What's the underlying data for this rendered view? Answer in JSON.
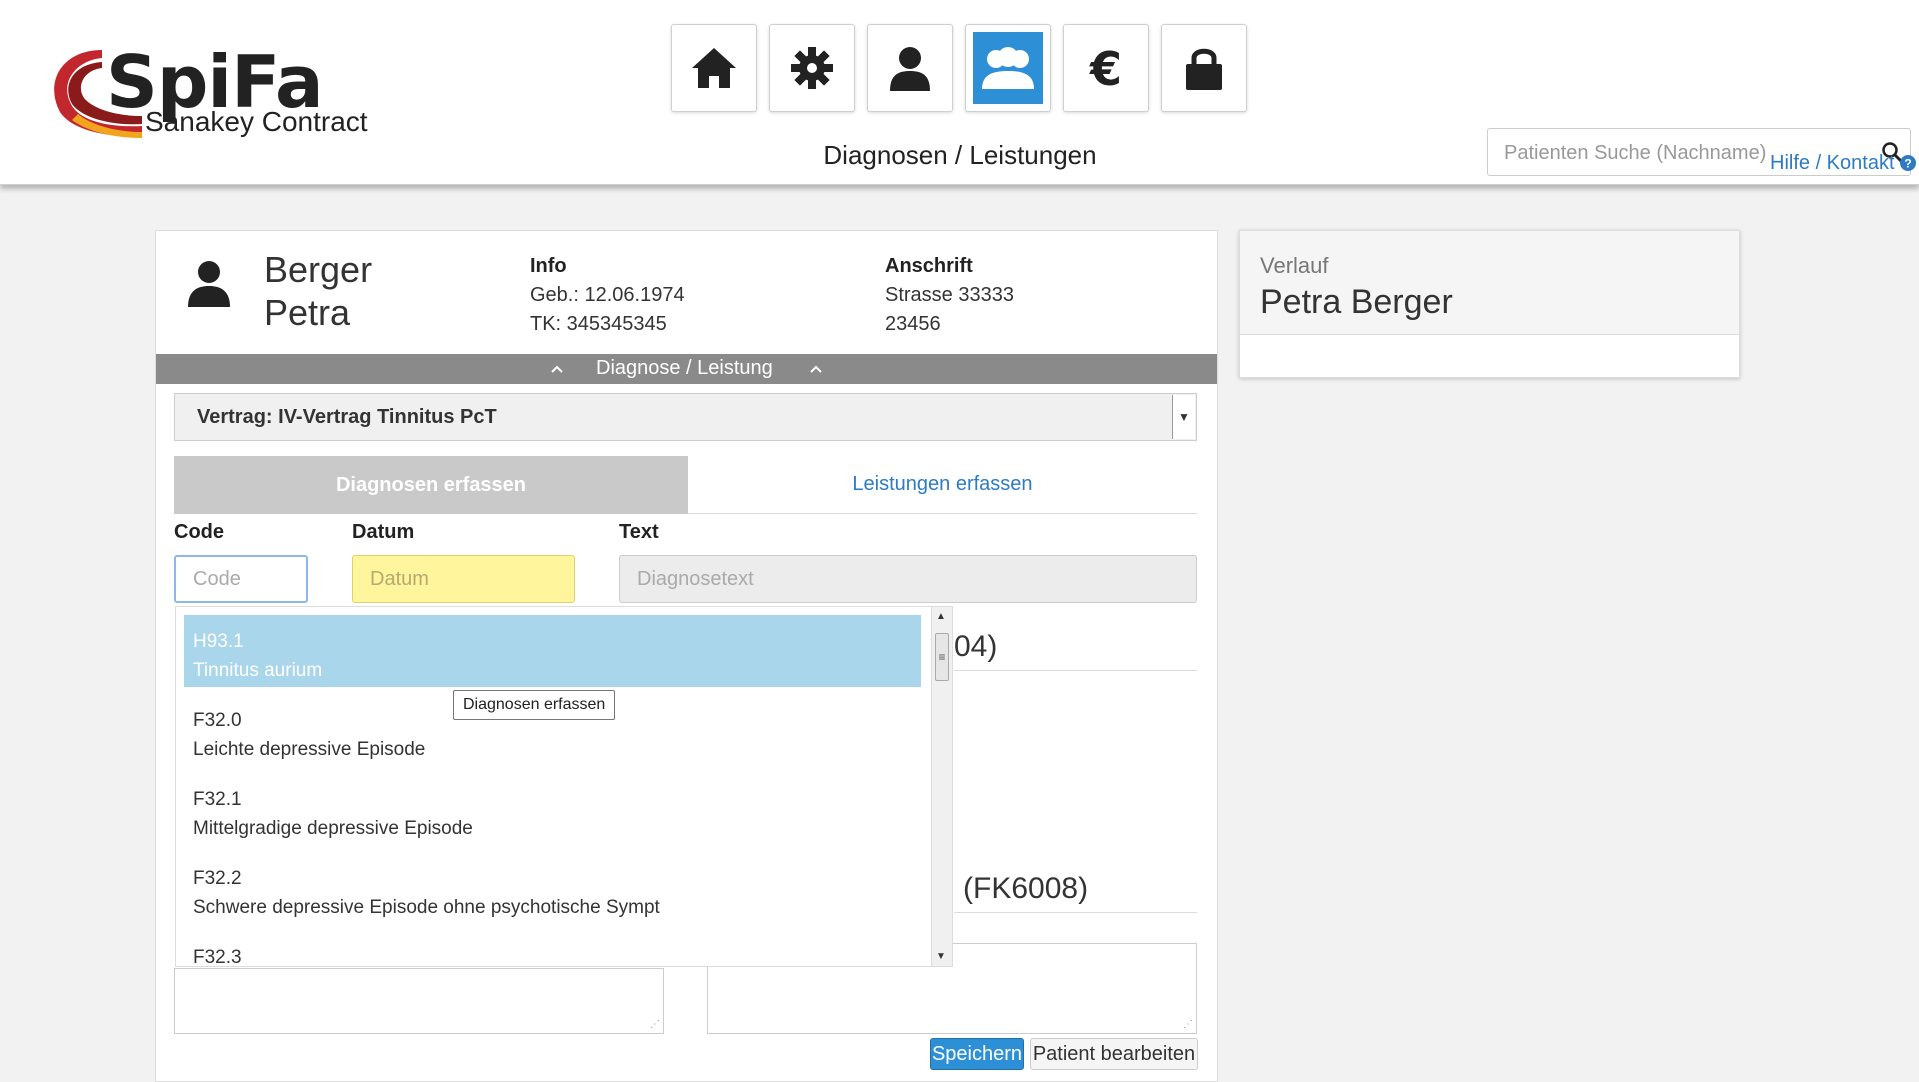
{
  "header": {
    "logo": {
      "word": "SpiFa",
      "subtitle": "Sanakey Contract"
    },
    "nav": [
      {
        "icon": "home-icon",
        "active": false
      },
      {
        "icon": "gear-icon",
        "active": false
      },
      {
        "icon": "user-icon",
        "active": false
      },
      {
        "icon": "users-icon",
        "active": true
      },
      {
        "icon": "euro-icon",
        "active": false
      },
      {
        "icon": "lock-icon",
        "active": false
      }
    ],
    "page_title": "Diagnosen / Leistungen",
    "search_placeholder": "Patienten Suche (Nachname)",
    "help_link": "Hilfe / Kontakt"
  },
  "patient": {
    "last_name": "Berger",
    "first_name": "Petra",
    "info_label": "Info",
    "birth": "Geb.: 12.06.1974",
    "tk": "TK: 345345345",
    "address_label": "Anschrift",
    "street": "Strasse 33333",
    "zip": "23456"
  },
  "section_bar": "Diagnose / Leistung",
  "contract": "Vertrag: IV-Vertrag Tinnitus PcT",
  "tabs": {
    "diagnosen": "Diagnosen erfassen",
    "leistungen": "Leistungen erfassen"
  },
  "fields": {
    "code_label": "Code",
    "code_placeholder": "Code",
    "date_label": "Datum",
    "date_placeholder": "Datum",
    "text_label": "Text",
    "text_placeholder": "Diagnosetext"
  },
  "background_fragments": {
    "first": "04)",
    "second": "(FK6008)"
  },
  "dropdown": [
    {
      "code": "H93.1",
      "text": "Tinnitus aurium",
      "selected": true
    },
    {
      "code": "F32.0",
      "text": "Leichte depressive Episode",
      "selected": false
    },
    {
      "code": "F32.1",
      "text": "Mittelgradige depressive Episode",
      "selected": false
    },
    {
      "code": "F32.2",
      "text": "Schwere depressive Episode ohne psychotische Sympt",
      "selected": false
    },
    {
      "code": "F32.3",
      "text": "",
      "selected": false
    }
  ],
  "tooltip": "Diagnosen erfassen",
  "buttons": {
    "save": "Speichern",
    "edit": "Patient bearbeiten"
  },
  "verlauf": {
    "label": "Verlauf",
    "name": "Petra Berger"
  },
  "colors": {
    "accent": "#2d8fd5",
    "selected_row": "#a9d6ea",
    "date_field": "#fff59d",
    "link": "#2d7bc5"
  }
}
